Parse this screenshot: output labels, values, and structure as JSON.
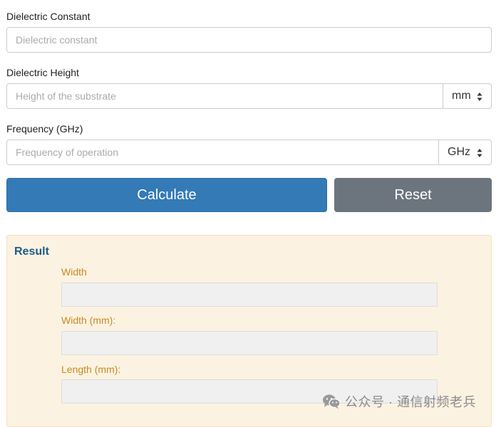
{
  "form": {
    "dielectric_constant": {
      "label": "Dielectric Constant",
      "placeholder": "Dielectric constant",
      "value": ""
    },
    "dielectric_height": {
      "label": "Dielectric Height",
      "placeholder": "Height of the substrate",
      "value": "",
      "unit": "mm"
    },
    "frequency": {
      "label": "Frequency (GHz)",
      "placeholder": "Frequency of operation",
      "value": "",
      "unit": "GHz"
    }
  },
  "buttons": {
    "calculate": "Calculate",
    "reset": "Reset"
  },
  "result": {
    "title": "Result",
    "fields": [
      {
        "label": "Width",
        "value": ""
      },
      {
        "label": "Width (mm):",
        "value": ""
      },
      {
        "label": "Length (mm):",
        "value": ""
      }
    ]
  },
  "watermark": {
    "text": "公众号 · 通信射频老兵",
    "icon": "wechat-icon"
  },
  "colors": {
    "primary": "#337ab7",
    "secondary": "#6c757d",
    "result_bg": "#fcf2e2",
    "result_title": "#1d5c88",
    "result_label": "#c78a1d"
  }
}
